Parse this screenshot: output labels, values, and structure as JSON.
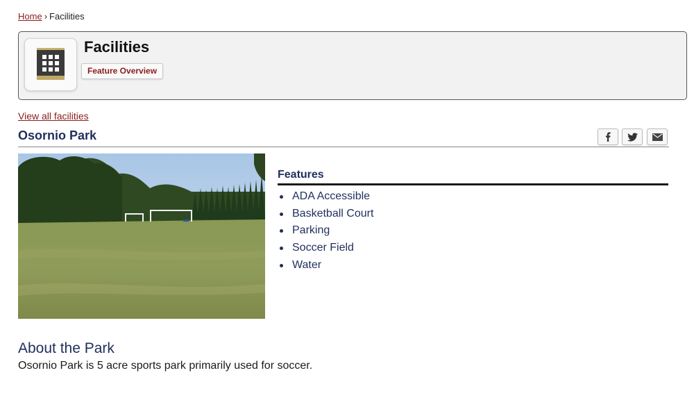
{
  "breadcrumb": {
    "home": "Home",
    "separator": "›",
    "current": "Facilities"
  },
  "module": {
    "title": "Facilities",
    "icon": "building-icon",
    "overview_button": "Feature Overview"
  },
  "view_all_link": "View all facilities",
  "facility": {
    "name": "Osornio Park",
    "photo": "park-photo",
    "features_heading": "Features",
    "features": [
      "ADA Accessible",
      "Basketball Court",
      "Parking",
      "Soccer Field",
      "Water"
    ],
    "about_heading": "About the Park",
    "about_text": "Osornio Park is 5 acre sports park primarily used for soccer."
  },
  "share": {
    "icons": [
      "facebook-icon",
      "twitter-icon",
      "email-icon"
    ]
  },
  "colors": {
    "link": "#8a1c1c",
    "heading": "#1f2f5c",
    "header_bg": "#f2f2f2"
  }
}
